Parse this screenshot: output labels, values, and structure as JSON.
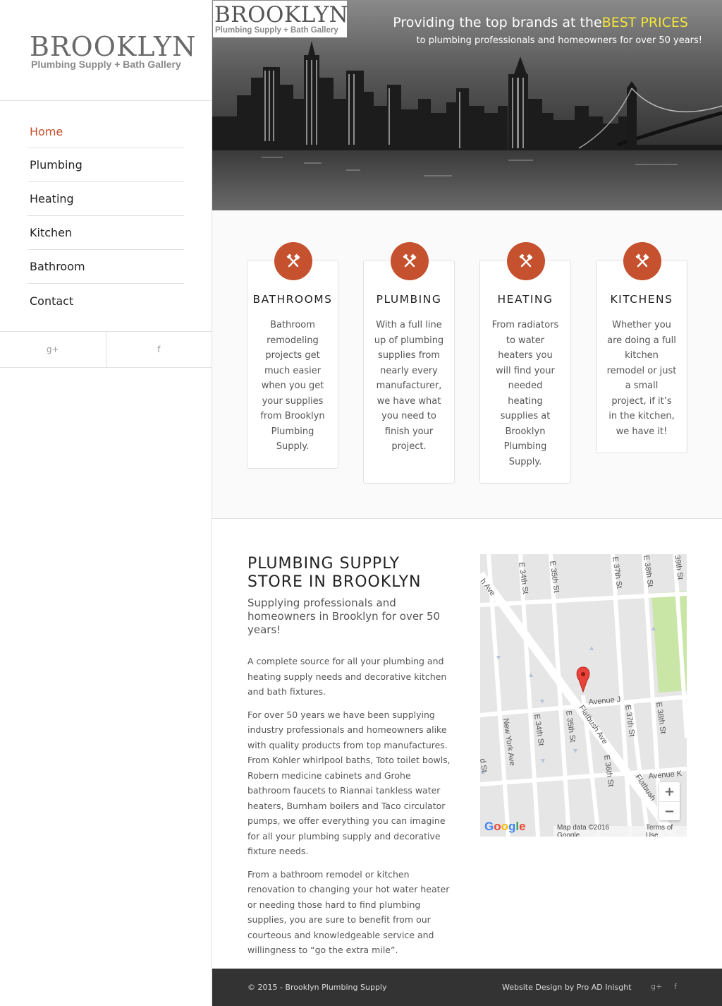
{
  "logo": {
    "title": "BROOKLYN",
    "subtitle": "Plumbing Supply + Bath Gallery"
  },
  "nav": {
    "items": [
      {
        "label": "Home",
        "active": true
      },
      {
        "label": "Plumbing"
      },
      {
        "label": "Heating"
      },
      {
        "label": "Kitchen"
      },
      {
        "label": "Bathroom"
      },
      {
        "label": "Contact"
      }
    ]
  },
  "social": {
    "google_plus_icon": "g+",
    "facebook_icon": "f"
  },
  "hero": {
    "headline_prefix": "Providing the top brands at the",
    "headline_accent": "BEST PRICES",
    "subline": "to plumbing professionals and homeowners for over 50 years!",
    "accent_color": "#f4e63a"
  },
  "features": [
    {
      "title": "BATHROOMS",
      "text": "Bathroom remodeling projects get much easier when you get your supplies from Brooklyn Plumbing Supply.",
      "icon": "tools-icon"
    },
    {
      "title": "PLUMBING",
      "text": "With a full line up of plumbing supplies from nearly every manufacturer, we have what you need to finish your project.",
      "icon": "tools-icon"
    },
    {
      "title": "HEATING",
      "text": "From radiators to water heaters you will find your needed heating supplies at Brooklyn Plumbing Supply.",
      "icon": "tools-icon"
    },
    {
      "title": "KITCHENS",
      "text": "Whether you are doing a full kitchen remodel or just a small project, if it’s in the kitchen, we have it!",
      "icon": "tools-icon"
    }
  ],
  "brand_color": "#c5512f",
  "content": {
    "title": "PLUMBING SUPPLY STORE IN BROOKLYN",
    "subtitle": "Supplying professionals and homeowners in Brooklyn for over 50 years!",
    "paragraphs": [
      "A complete source for all your plumbing and heating supply needs and decorative kitchen and bath fixtures.",
      "For over 50 years we have been supplying industry professionals and homeowners alike with quality products from top manufactures. From Kohler whirlpool baths, Toto toilet bowls, Robern medicine cabinets and Grohe bathroom faucets to Riannai tankless water heaters, Burnham boilers and Taco circulator pumps, we offer everything you can imagine for all your plumbing supply and decorative fixture needs.",
      "From a bathroom remodel or kitchen renovation to changing your hot water heater or needing those hard to find plumbing supplies, you are sure to benefit from our courteous and knowledgeable service and willingness to “go the extra mile”."
    ]
  },
  "map": {
    "streets": [
      "E 34th St",
      "E 35th St",
      "E 37th St",
      "E 38th St",
      "39th St",
      "h Ave",
      "Avenue J",
      "New York Ave",
      "E 34th St",
      "E 35th St",
      "Flatbush Ave",
      "E 36th St",
      "E 37th St",
      "E 38th St",
      "Avenue K",
      "Flatbush",
      "d St"
    ],
    "zoom_in": "+",
    "zoom_out": "−",
    "google": "Google",
    "map_data": "Map data ©2016 Google",
    "terms": "Terms of Use"
  },
  "footer": {
    "copyright": "© 2015 - Brooklyn Plumbing Supply",
    "credit": "Website Design by Pro AD Inisght",
    "google_plus_icon": "g+",
    "facebook_icon": "f"
  }
}
